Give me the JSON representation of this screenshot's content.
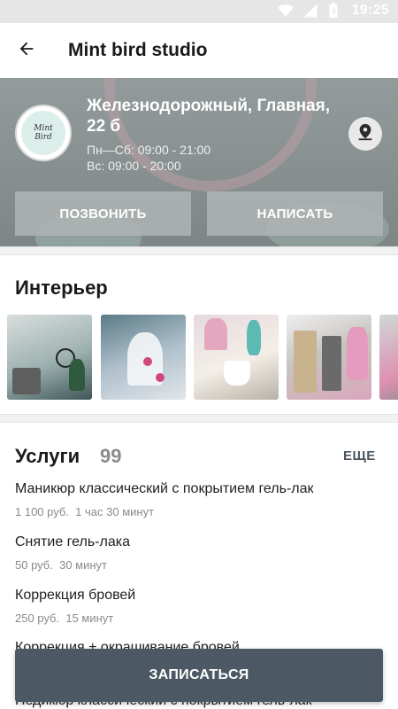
{
  "status_bar": {
    "time": "19:25"
  },
  "app_bar": {
    "title": "Mint bird studio"
  },
  "header": {
    "address": "Железнодорожный, Главная, 22 б",
    "hours_weekdays": "Пн—Сб: 09:00 - 21:00",
    "hours_sunday": "Вс: 09:00 - 20:00",
    "call_label": "ПОЗВОНИТЬ",
    "write_label": "НАПИСАТЬ"
  },
  "interior": {
    "title": "Интерьер"
  },
  "services": {
    "title": "Услуги",
    "count": "99",
    "more_label": "ЕЩЕ",
    "items": [
      {
        "name": "Маникюр классический с покрытием гель-лак",
        "price": "1 100 руб.",
        "duration": "1 час 30 минут"
      },
      {
        "name": "Снятие гель-лака",
        "price": "50 руб.",
        "duration": "30 минут"
      },
      {
        "name": "Коррекция бровей",
        "price": "250 руб.",
        "duration": "15 минут"
      },
      {
        "name": "Коррекция + окрашивание бровей",
        "price": "",
        "duration": ""
      },
      {
        "name": "Педикюр классический с покрытием гель-лак",
        "price": "",
        "duration": ""
      }
    ]
  },
  "book_button": {
    "label": "ЗАПИСАТЬСЯ"
  }
}
